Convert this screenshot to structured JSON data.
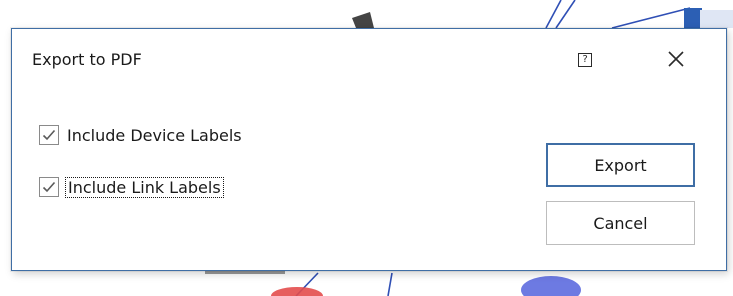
{
  "dialog": {
    "title": "Export to PDF",
    "help_glyph": "?",
    "options": [
      {
        "label": "Include Device Labels",
        "checked": true
      },
      {
        "label": "Include Link Labels",
        "checked": true
      }
    ],
    "export_label": "Export",
    "cancel_label": "Cancel"
  },
  "colors": {
    "dialog_border": "#3f6ea5",
    "default_button_border": "#3f6ea5",
    "checkbox_border": "#8a8a8a",
    "check_mark": "#5a5a5a",
    "background_links": "#2f4fb5"
  },
  "icons": [
    "help-icon",
    "close-icon",
    "checkmark-icon"
  ]
}
